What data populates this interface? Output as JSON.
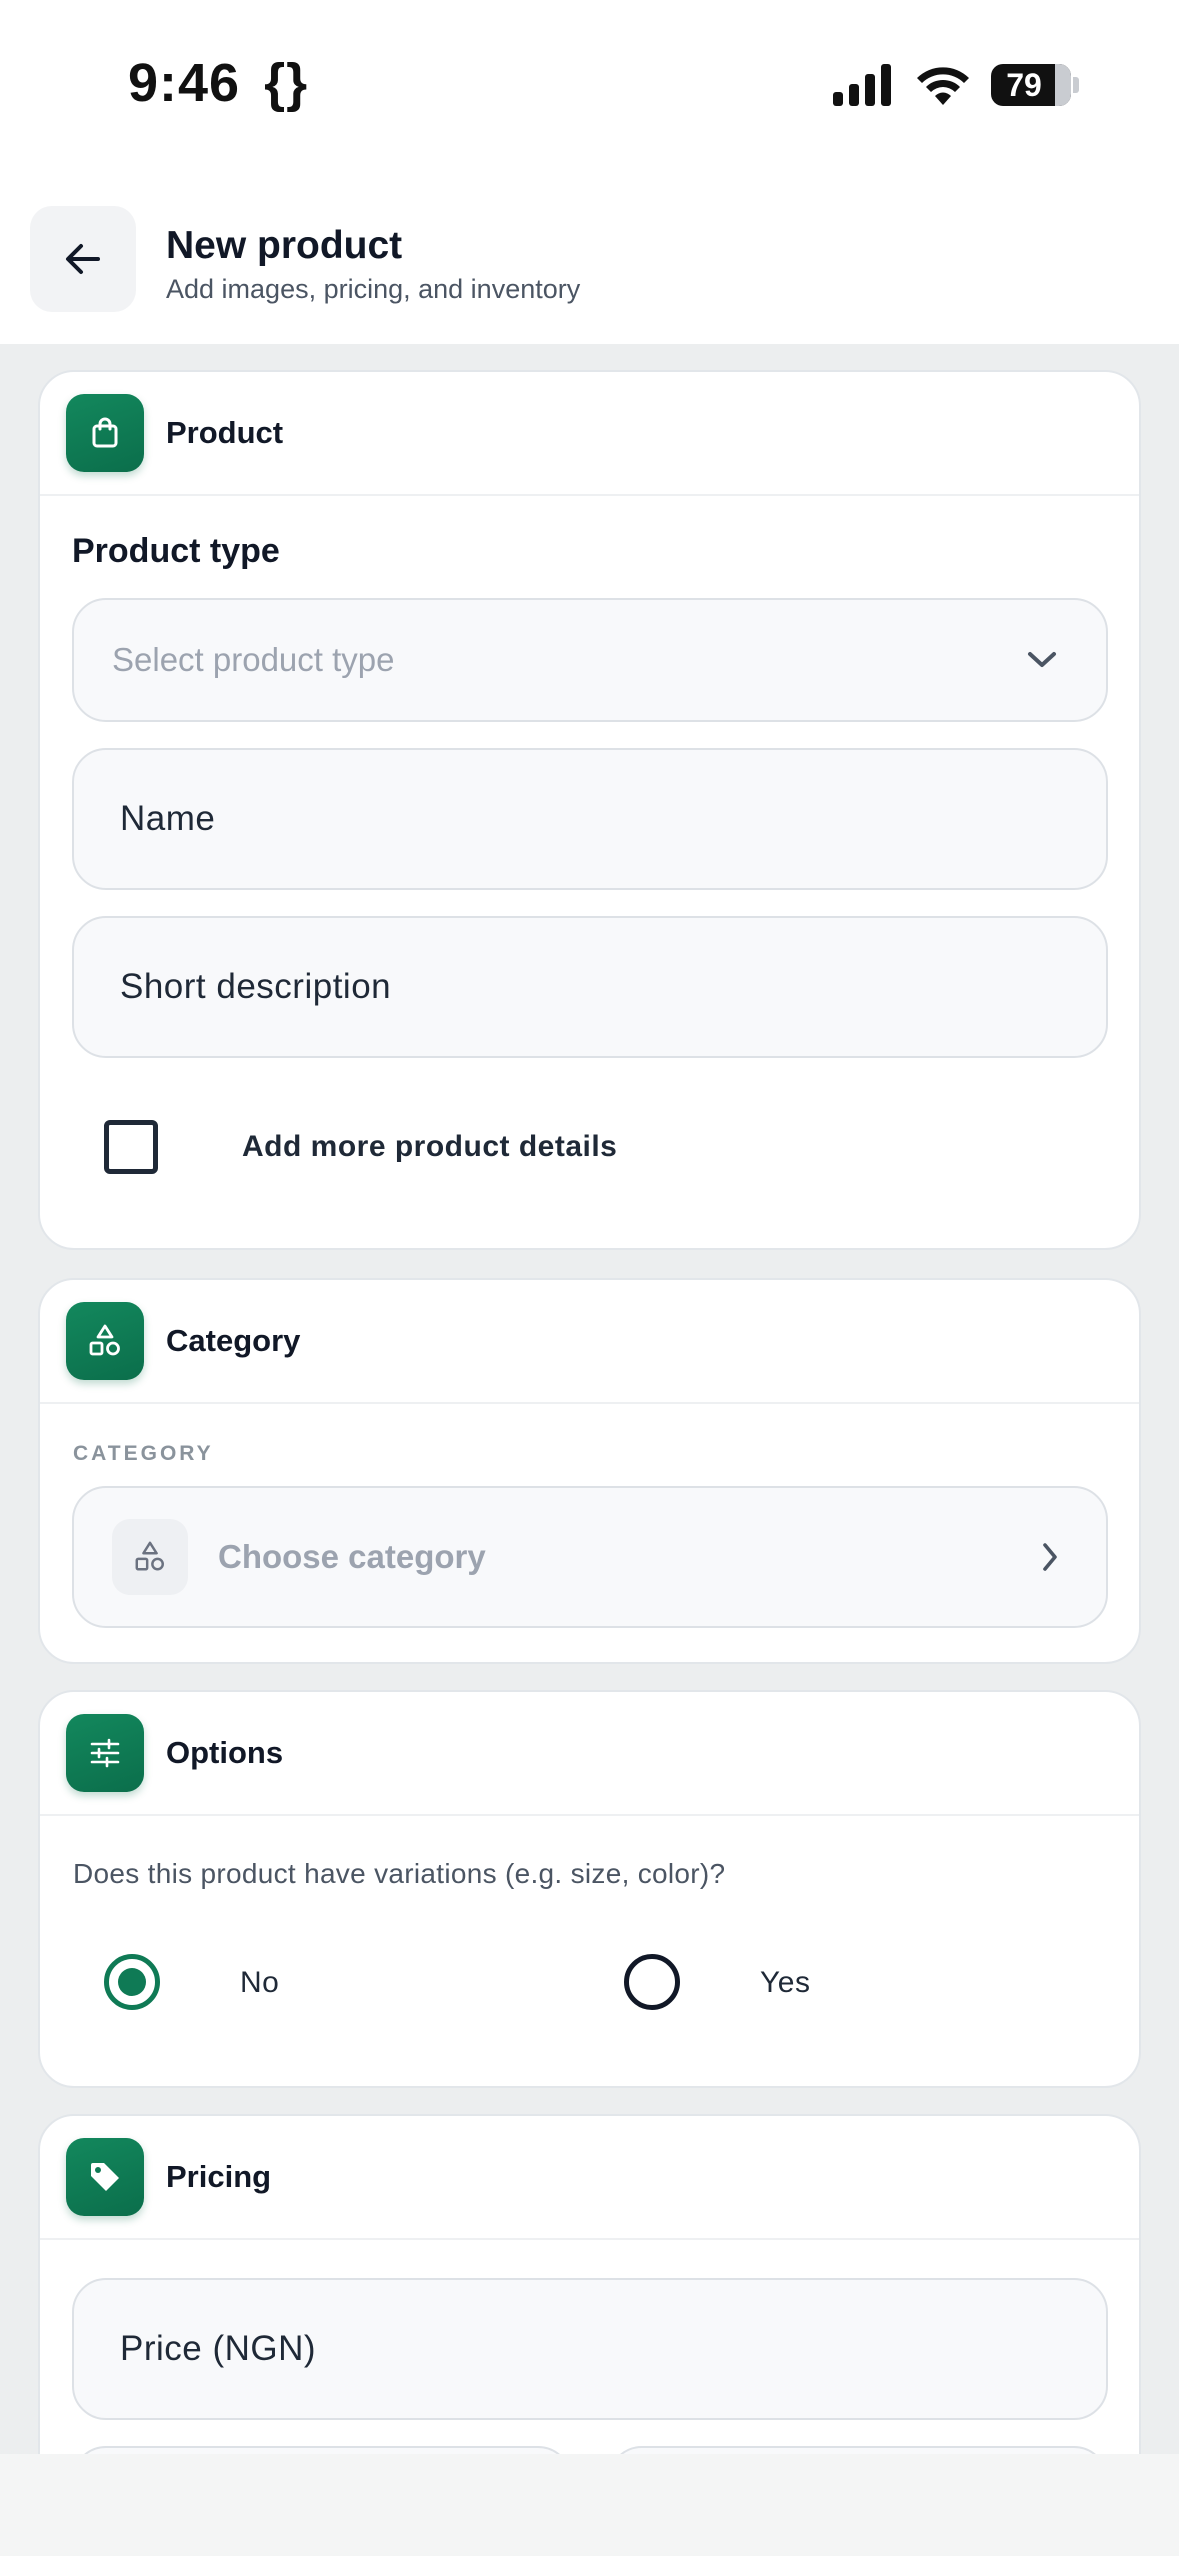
{
  "status": {
    "time": "9:46",
    "dev_icon": "{}",
    "battery": "79"
  },
  "header": {
    "title": "New product",
    "subtitle": "Add images, pricing, and inventory"
  },
  "product": {
    "title": "Product",
    "type_label": "Product type",
    "type_placeholder": "Select product type",
    "name_placeholder": "Name",
    "description_placeholder": "Short description",
    "more_details_label": "Add more product details"
  },
  "category": {
    "title": "Category",
    "field_label": "CATEGORY",
    "placeholder": "Choose category"
  },
  "options": {
    "title": "Options",
    "question": "Does this product have variations (e.g. size, color)?",
    "no_label": "No",
    "yes_label": "Yes",
    "selected": "No"
  },
  "pricing": {
    "title": "Pricing",
    "price_placeholder": "Price (NGN)"
  },
  "colors": {
    "accent": "#0f7a55",
    "background": "#eceeef"
  },
  "icons": [
    "back-arrow-icon",
    "shopping-bag-icon",
    "shapes-icon",
    "sliders-icon",
    "tag-icon",
    "chevron-down-icon",
    "chevron-right-icon",
    "signal-icon",
    "wifi-icon",
    "battery-icon"
  ]
}
